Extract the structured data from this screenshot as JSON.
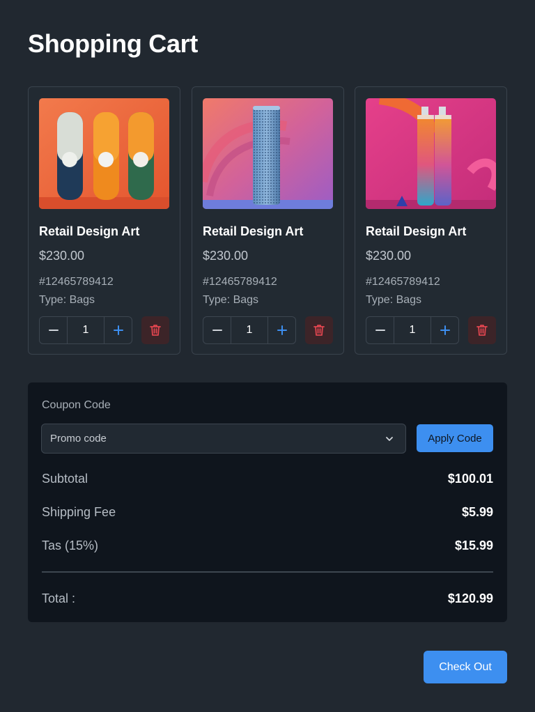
{
  "page": {
    "title": "Shopping Cart"
  },
  "products": [
    {
      "name": "Retail Design Art",
      "price": "$230.00",
      "sku": "#12465789412",
      "type": "Type: Bags",
      "quantity": "1",
      "image": "three-capsule-containers-image"
    },
    {
      "name": "Retail Design Art",
      "price": "$230.00",
      "sku": "#12465789412",
      "type": "Type: Bags",
      "quantity": "1",
      "image": "perforated-speaker-image"
    },
    {
      "name": "Retail Design Art",
      "price": "$230.00",
      "sku": "#12465789412",
      "type": "Type: Bags",
      "quantity": "1",
      "image": "spray-bottles-image"
    }
  ],
  "coupon": {
    "label": "Coupon Code",
    "select_value": "Promo code",
    "apply_label": "Apply Code"
  },
  "totals": {
    "subtotal_label": "Subtotal",
    "subtotal_value": "$100.01",
    "shipping_label": "Shipping Fee",
    "shipping_value": "$5.99",
    "tax_label": "Tas (15%)",
    "tax_value": "$15.99",
    "total_label": "Total :",
    "total_value": "$120.99"
  },
  "checkout_label": "Check Out",
  "colors": {
    "accent": "#3d8ff0",
    "danger": "#e0454f",
    "background": "#212830",
    "panel": "#0f151d"
  },
  "icons": {
    "minus": "minus-icon",
    "plus": "plus-icon",
    "delete": "trash-icon",
    "dropdown": "chevron-down-icon"
  }
}
